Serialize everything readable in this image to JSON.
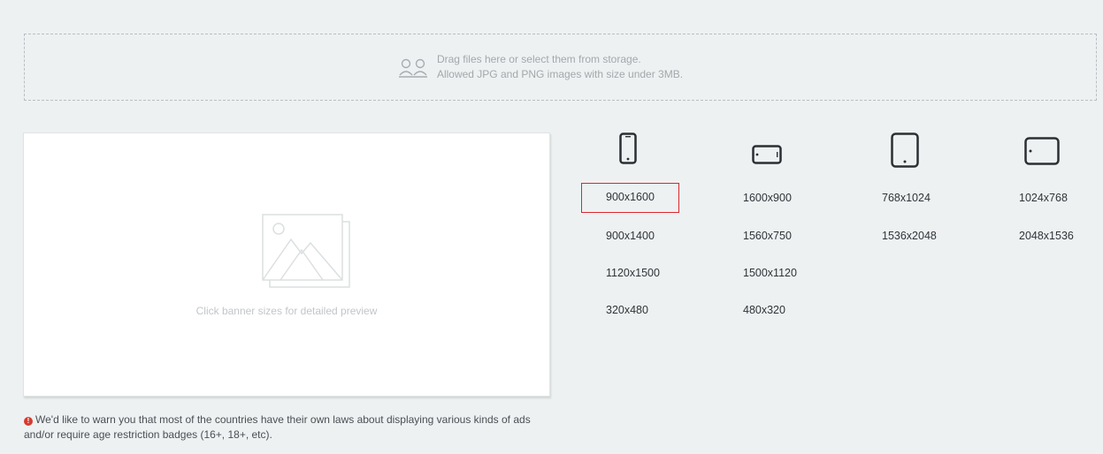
{
  "dropzone": {
    "line1": "Drag files here or select them from storage.",
    "line2": "Allowed JPG and PNG images with size under 3MB.",
    "icon": "people-upload-icon"
  },
  "preview": {
    "caption": "Click banner sizes for detailed preview",
    "icon": "image-placeholder-icon"
  },
  "warning": {
    "text": "We'd like to warn you that most of the countries have their own laws about displaying various kinds of ads and/or require age restriction badges (16+, 18+, etc)."
  },
  "devices": [
    {
      "icon": "phone-portrait-icon",
      "sizes": [
        "900x1600",
        "900x1400",
        "1120x1500",
        "320x480"
      ]
    },
    {
      "icon": "phone-landscape-icon",
      "sizes": [
        "1600x900",
        "1560x750",
        "1500x1120",
        "480x320"
      ]
    },
    {
      "icon": "tablet-portrait-icon",
      "sizes": [
        "768x1024",
        "1536x2048"
      ]
    },
    {
      "icon": "tablet-landscape-icon",
      "sizes": [
        "1024x768",
        "2048x1536"
      ]
    }
  ],
  "selected_size": "900x1600",
  "colors": {
    "accent_red": "#d9272e",
    "warning_red": "#d63b30",
    "background": "#eef1f2"
  }
}
